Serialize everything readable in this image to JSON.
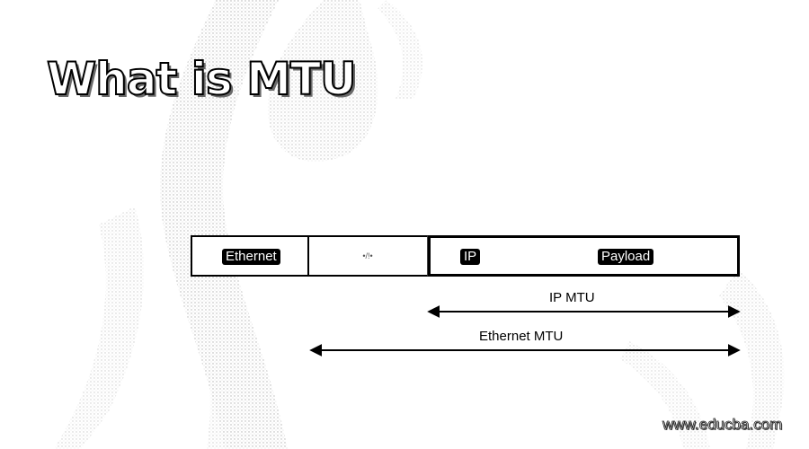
{
  "title": "What is MTU",
  "frame": {
    "ethernet_label": "Ethernet",
    "middle_label": "•/!•",
    "ip_label": "IP",
    "payload_label": "Payload"
  },
  "ip_mtu_label": "IP MTU",
  "ethernet_mtu_label": "Ethernet MTU",
  "watermark": "www.educba.com",
  "colors": {
    "background": "#ffffff",
    "outline": "#000000",
    "texture": "#b8b8b8"
  }
}
